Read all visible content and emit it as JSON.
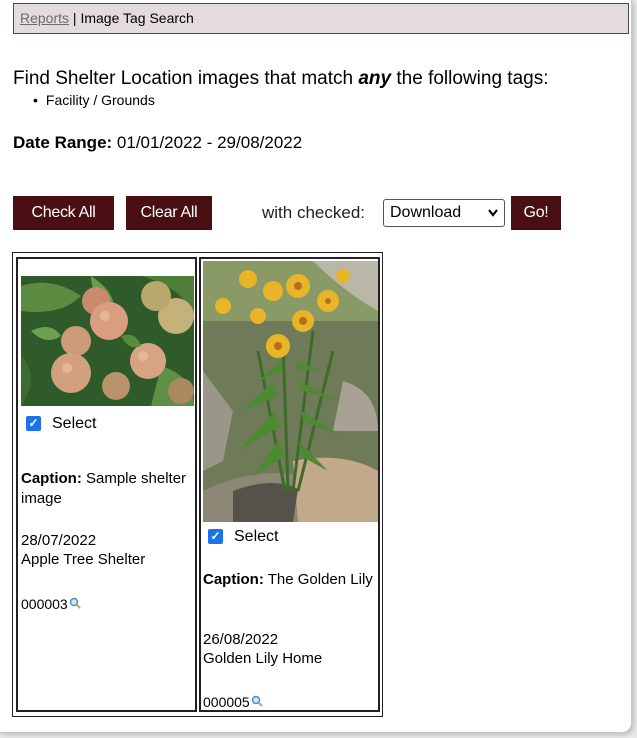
{
  "breadcrumb": {
    "link": "Reports",
    "separator": " | ",
    "current": "Image Tag Search"
  },
  "heading": {
    "prefix": "Find Shelter Location images that match ",
    "emphasis": "any",
    "suffix": " the following tags:"
  },
  "tags": [
    "Facility / Grounds"
  ],
  "date_range": {
    "label": "Date Range:",
    "value": " 01/01/2022 - 29/08/2022"
  },
  "actions": {
    "check_all": "Check All",
    "clear_all": "Clear All",
    "with_checked_label": "with checked:",
    "selected_action": "Download",
    "go": "Go!"
  },
  "images": [
    {
      "select_label": "Select",
      "checked": true,
      "caption_label": "Caption:",
      "caption": " Sample shelter image",
      "date": "28/07/2022",
      "location": "Apple Tree Shelter",
      "id": "000003",
      "image": "apples-photo"
    },
    {
      "select_label": "Select",
      "checked": true,
      "caption_label": "Caption:",
      "caption": " The Golden Lily",
      "date": "26/08/2022",
      "location": "Golden Lily Home",
      "id": "000005",
      "image": "lily-photo"
    }
  ],
  "colors": {
    "button_bg": "#4a0f13",
    "topbar_bg": "#e4dcdc",
    "checkbox": "#1a73e8"
  }
}
